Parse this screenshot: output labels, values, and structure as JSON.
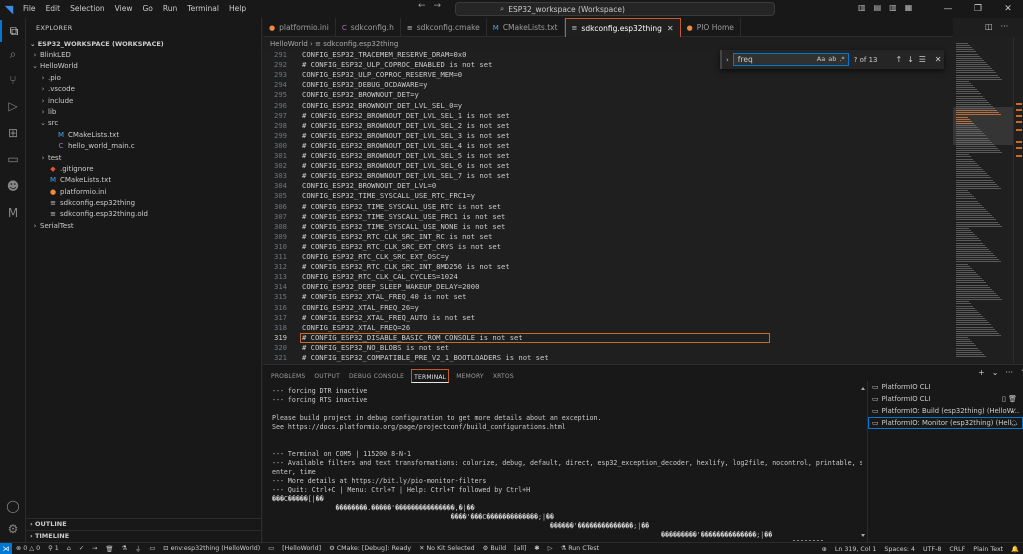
{
  "titlebar": {
    "menu": [
      "File",
      "Edit",
      "Selection",
      "View",
      "Go",
      "Run",
      "Terminal",
      "Help"
    ],
    "command_center": "ESP32_workspace (Workspace)"
  },
  "explorer": {
    "header": "EXPLORER",
    "workspace": "ESP32_WORKSPACE (WORKSPACE)",
    "tree": [
      {
        "label": "BlinkLED",
        "indent": 0,
        "chev": "›",
        "icon": ""
      },
      {
        "label": "HelloWorld",
        "indent": 0,
        "chev": "⌄",
        "icon": ""
      },
      {
        "label": ".pio",
        "indent": 1,
        "chev": "›",
        "icon": ""
      },
      {
        "label": ".vscode",
        "indent": 1,
        "chev": "›",
        "icon": ""
      },
      {
        "label": "include",
        "indent": 1,
        "chev": "›",
        "icon": ""
      },
      {
        "label": "lib",
        "indent": 1,
        "chev": "›",
        "icon": ""
      },
      {
        "label": "src",
        "indent": 1,
        "chev": "⌄",
        "icon": ""
      },
      {
        "label": "CMakeLists.txt",
        "indent": 2,
        "chev": "",
        "icon": "M"
      },
      {
        "label": "hello_world_main.c",
        "indent": 2,
        "chev": "",
        "icon": "C"
      },
      {
        "label": "test",
        "indent": 1,
        "chev": "›",
        "icon": ""
      },
      {
        "label": ".gitignore",
        "indent": 1,
        "chev": "",
        "icon": "◆"
      },
      {
        "label": "CMakeLists.txt",
        "indent": 1,
        "chev": "",
        "icon": "M"
      },
      {
        "label": "platformio.ini",
        "indent": 1,
        "chev": "",
        "icon": "●"
      },
      {
        "label": "sdkconfig.esp32thing",
        "indent": 1,
        "chev": "",
        "icon": "≡"
      },
      {
        "label": "sdkconfig.esp32thing.old",
        "indent": 1,
        "chev": "",
        "icon": "≡"
      },
      {
        "label": "SerialTest",
        "indent": 0,
        "chev": "›",
        "icon": ""
      }
    ],
    "outline": "OUTLINE",
    "timeline": "TIMELINE"
  },
  "tabs": [
    {
      "label": "platformio.ini",
      "icon": "●",
      "color": "#f0883e",
      "active": false
    },
    {
      "label": "sdkconfig.h",
      "icon": "C",
      "color": "#a074c4",
      "active": false
    },
    {
      "label": "sdkconfig.cmake",
      "icon": "≡",
      "color": "#cccccc",
      "active": false
    },
    {
      "label": "CMakeLists.txt",
      "icon": "M",
      "color": "#4aa5f0",
      "active": false
    },
    {
      "label": "sdkconfig.esp32thing",
      "icon": "≡",
      "color": "#cccccc",
      "active": true
    },
    {
      "label": "PIO Home",
      "icon": "●",
      "color": "#f0883e",
      "active": false
    }
  ],
  "breadcrumb": {
    "folder": "HelloWorld",
    "sep": "›",
    "file": "sdkconfig.esp32thing"
  },
  "find": {
    "query": "freq",
    "count": "? of 13",
    "match_case": "Aa",
    "whole_word": "ab",
    "regex": ".*"
  },
  "editor": {
    "current_line": 319,
    "lines": [
      {
        "n": 291,
        "t": "CONFIG_ESP32_TRACEMEM_RESERVE_DRAM=0x0"
      },
      {
        "n": 292,
        "t": "# CONFIG_ESP32_ULP_COPROC_ENABLED is not set"
      },
      {
        "n": 293,
        "t": "CONFIG_ESP32_ULP_COPROC_RESERVE_MEM=0"
      },
      {
        "n": 294,
        "t": "CONFIG_ESP32_DEBUG_OCDAWARE=y"
      },
      {
        "n": 295,
        "t": "CONFIG_ESP32_BROWNOUT_DET=y"
      },
      {
        "n": 296,
        "t": "CONFIG_ESP32_BROWNOUT_DET_LVL_SEL_0=y"
      },
      {
        "n": 297,
        "t": "# CONFIG_ESP32_BROWNOUT_DET_LVL_SEL_1 is not set"
      },
      {
        "n": 298,
        "t": "# CONFIG_ESP32_BROWNOUT_DET_LVL_SEL_2 is not set"
      },
      {
        "n": 299,
        "t": "# CONFIG_ESP32_BROWNOUT_DET_LVL_SEL_3 is not set"
      },
      {
        "n": 300,
        "t": "# CONFIG_ESP32_BROWNOUT_DET_LVL_SEL_4 is not set"
      },
      {
        "n": 301,
        "t": "# CONFIG_ESP32_BROWNOUT_DET_LVL_SEL_5 is not set"
      },
      {
        "n": 302,
        "t": "# CONFIG_ESP32_BROWNOUT_DET_LVL_SEL_6 is not set"
      },
      {
        "n": 303,
        "t": "# CONFIG_ESP32_BROWNOUT_DET_LVL_SEL_7 is not set"
      },
      {
        "n": 304,
        "t": "CONFIG_ESP32_BROWNOUT_DET_LVL=0"
      },
      {
        "n": 305,
        "t": "CONFIG_ESP32_TIME_SYSCALL_USE_RTC_FRC1=y"
      },
      {
        "n": 306,
        "t": "# CONFIG_ESP32_TIME_SYSCALL_USE_RTC is not set"
      },
      {
        "n": 307,
        "t": "# CONFIG_ESP32_TIME_SYSCALL_USE_FRC1 is not set"
      },
      {
        "n": 308,
        "t": "# CONFIG_ESP32_TIME_SYSCALL_USE_NONE is not set"
      },
      {
        "n": 309,
        "t": "# CONFIG_ESP32_RTC_CLK_SRC_INT_RC is not set"
      },
      {
        "n": 310,
        "t": "# CONFIG_ESP32_RTC_CLK_SRC_EXT_CRYS is not set"
      },
      {
        "n": 311,
        "t": "CONFIG_ESP32_RTC_CLK_SRC_EXT_OSC=y"
      },
      {
        "n": 312,
        "t": "# CONFIG_ESP32_RTC_CLK_SRC_INT_8MD256 is not set"
      },
      {
        "n": 313,
        "t": "CONFIG_ESP32_RTC_CLK_CAL_CYCLES=1024"
      },
      {
        "n": 314,
        "t": "CONFIG_ESP32_DEEP_SLEEP_WAKEUP_DELAY=2000"
      },
      {
        "n": 315,
        "t": "# CONFIG_ESP32_XTAL_FREQ_40 is not set"
      },
      {
        "n": 316,
        "t": "CONFIG_ESP32_XTAL_FREQ_26=y"
      },
      {
        "n": 317,
        "t": "# CONFIG_ESP32_XTAL_FREQ_AUTO is not set"
      },
      {
        "n": 318,
        "t": "CONFIG_ESP32_XTAL_FREQ=26"
      },
      {
        "n": 319,
        "t": "# CONFIG_ESP32_DISABLE_BASIC_ROM_CONSOLE is not set"
      },
      {
        "n": 320,
        "t": "# CONFIG_ESP32_NO_BLOBS is not set"
      },
      {
        "n": 321,
        "t": "# CONFIG_ESP32_COMPATIBLE_PRE_V2_1_BOOTLOADERS is not set"
      }
    ]
  },
  "panel": {
    "tabs": [
      {
        "label": "PROBLEMS",
        "active": false
      },
      {
        "label": "OUTPUT",
        "active": false
      },
      {
        "label": "DEBUG CONSOLE",
        "active": false
      },
      {
        "label": "TERMINAL",
        "active": true
      },
      {
        "label": "MEMORY",
        "active": false
      },
      {
        "label": "XRTOS",
        "active": false
      }
    ],
    "terminal_lines": [
      "--- forcing DTR inactive",
      "--- forcing RTS inactive",
      "",
      "Please build project in debug configuration to get more details about an exception.",
      "See https://docs.platformio.org/page/projectconf/build_configurations.html",
      "",
      "",
      "--- Terminal on COM5 | 115200 8-N-1",
      "--- Available filters and text transformations: colorize, debug, default, direct, esp32_exception_decoder, hexlify, log2file, nocontrol, printable, send_on_",
      "enter, time",
      "--- More details at https://bit.ly/pio-monitor-filters",
      "--- Quit: Ctrl+C | Menu: Ctrl+T | Help: Ctrl+T followed by Ctrl+H",
      "���C�����[|��",
      "                ��������.�����'���������������,�|��",
      "                                             ����'���C�������������;|��",
      "                                                                      ������'��������������;|��",
      "                                                                                                  ���������'��������������;|��",
      "                                                                                                                                   ��������"
    ],
    "terminals": [
      {
        "label": "PlatformIO CLI",
        "right": "",
        "selected": false
      },
      {
        "label": "PlatformIO CLI",
        "right": "▯ 🗑",
        "selected": false
      },
      {
        "label": "PlatformIO: Build (esp32thing) (HelloW...",
        "right": "✓",
        "selected": false
      },
      {
        "label": "PlatformIO: Monitor (esp32thing) (Hell...",
        "right": "◌",
        "selected": true
      }
    ]
  },
  "statusbar": {
    "errors": "0",
    "warnings": "0",
    "ports": "1",
    "env": "env:esp32thing (HelloWorld)",
    "project": "[HelloWorld]",
    "cmake": "CMake: [Debug]: Ready",
    "kit": "No Kit Selected",
    "build": "Build",
    "all": "[all]",
    "ctest": "Run CTest",
    "position": "Ln 319, Col 1",
    "spaces": "Spaces: 4",
    "encoding": "UTF-8",
    "eol": "CRLF",
    "language": "Plain Text"
  }
}
